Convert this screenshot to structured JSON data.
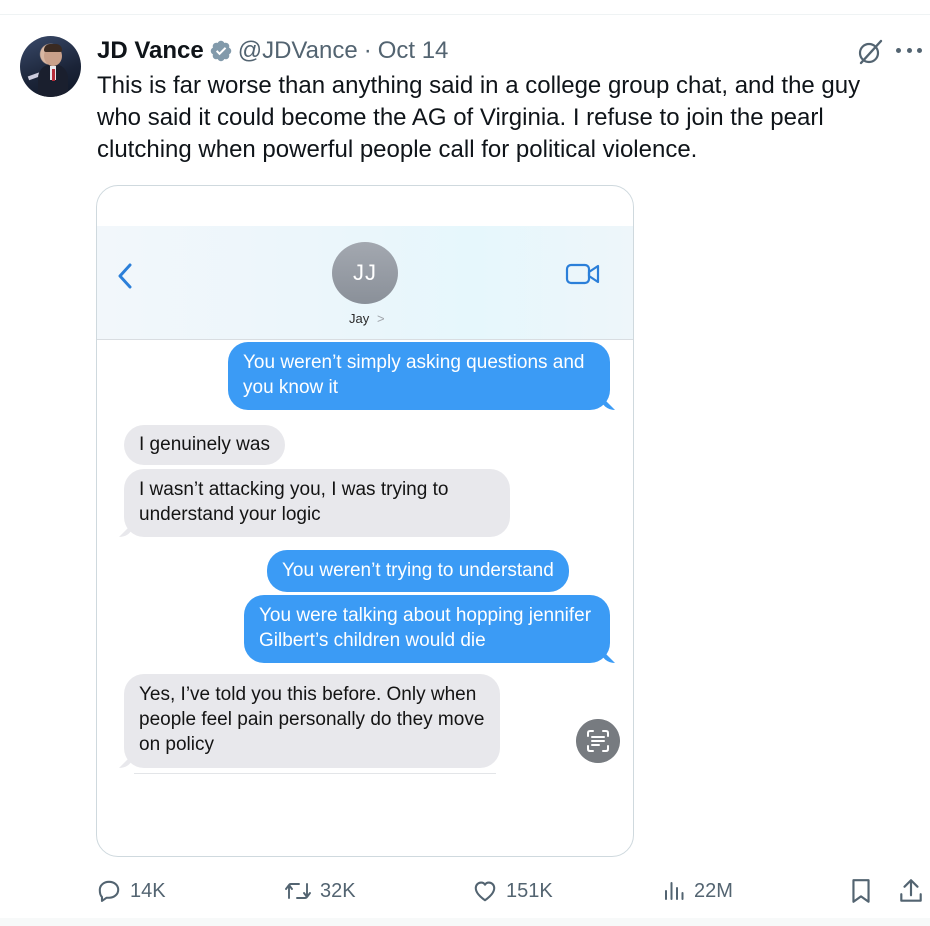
{
  "tweet": {
    "display_name": "JD Vance",
    "handle": "@JDVance",
    "separator": "·",
    "date": "Oct 14",
    "text": "This is far worse than anything said in a college group chat, and the guy who said it could become the AG of Virginia. I refuse to join the pearl clutching when powerful people call for political violence."
  },
  "media": {
    "contact_initials": "JJ",
    "contact_name": "Jay",
    "contact_chevron": ">",
    "messages": [
      {
        "side": "sent",
        "text": "You weren’t simply asking questions and you know it"
      },
      {
        "side": "received",
        "text": "I genuinely was"
      },
      {
        "side": "received",
        "text": "I wasn’t attacking you, I was trying to understand your logic"
      },
      {
        "side": "sent",
        "text": "You weren’t trying to understand"
      },
      {
        "side": "sent",
        "text": "You were talking about hopping jennifer Gilbert’s children would die"
      },
      {
        "side": "received",
        "text": "Yes, I’ve told you this before. Only when people feel pain personally do they move on policy"
      }
    ]
  },
  "actions": {
    "replies": "14K",
    "reposts": "32K",
    "likes": "151K",
    "views": "22M"
  },
  "colors": {
    "verified": "#829aab",
    "imessage_blue": "#3b9bf5",
    "imessage_gray": "#e8e8ec",
    "muted_text": "#536471"
  },
  "icons": [
    "verified-icon",
    "grok-icon",
    "more-icon",
    "back-icon",
    "video-call-icon",
    "live-text-icon",
    "reply-icon",
    "repost-icon",
    "like-icon",
    "views-icon",
    "bookmark-icon",
    "share-icon"
  ]
}
